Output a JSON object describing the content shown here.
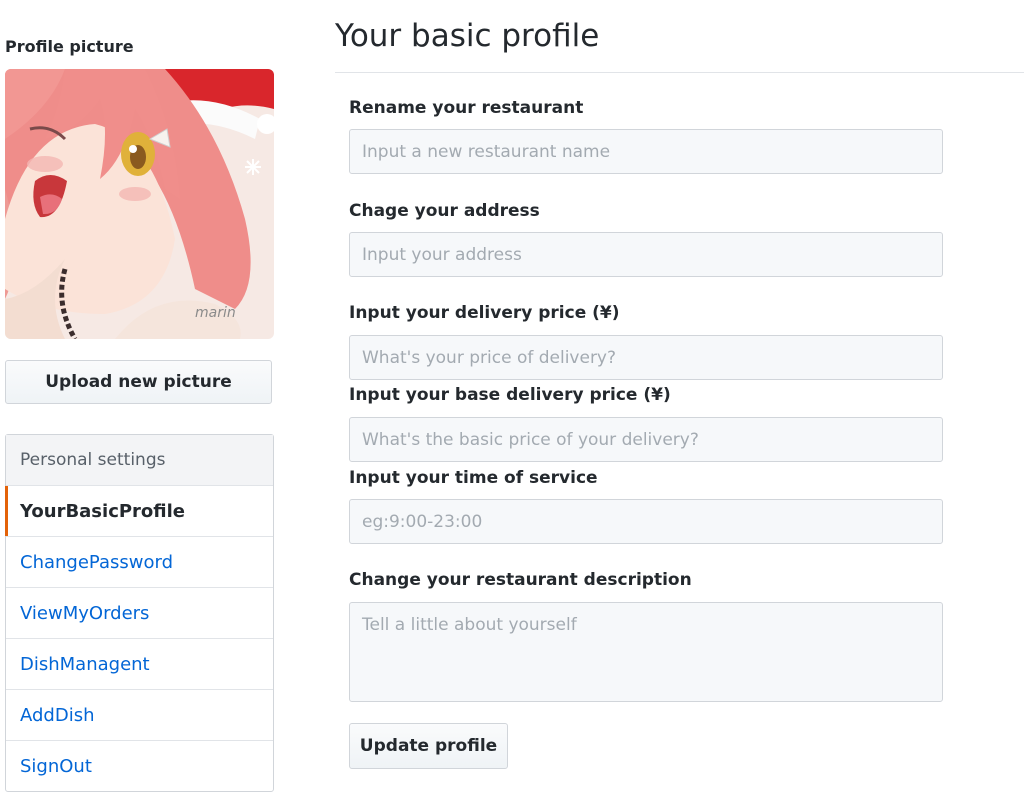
{
  "sidebar": {
    "profile_picture_label": "Profile picture",
    "avatar_signature": "marin",
    "upload_button": "Upload new picture",
    "menu_heading": "Personal settings",
    "items": [
      {
        "label": "YourBasicProfile",
        "selected": true
      },
      {
        "label": "ChangePassword",
        "selected": false
      },
      {
        "label": "ViewMyOrders",
        "selected": false
      },
      {
        "label": "DishManagent",
        "selected": false
      },
      {
        "label": "AddDish",
        "selected": false
      },
      {
        "label": "SignOut",
        "selected": false
      }
    ]
  },
  "main": {
    "title": "Your basic profile",
    "fields": {
      "rename": {
        "label": "Rename your restaurant",
        "placeholder": "Input a new restaurant name",
        "value": ""
      },
      "address": {
        "label": "Chage your address",
        "placeholder": "Input your address",
        "value": ""
      },
      "delivery_price": {
        "label": "Input your delivery price (¥)",
        "placeholder": "What's your price of delivery?",
        "value": ""
      },
      "base_delivery_price": {
        "label": "Input your base delivery price (¥)",
        "placeholder": "What's the basic price of your delivery?",
        "value": ""
      },
      "service_time": {
        "label": "Input your time of service",
        "placeholder": "eg:9:00-23:00",
        "value": ""
      },
      "description": {
        "label": "Change your restaurant description",
        "placeholder": "Tell a little about yourself",
        "value": ""
      }
    },
    "update_button": "Update profile"
  },
  "colors": {
    "link": "#0366d6",
    "selected_marker": "#e36209",
    "input_bg": "#f6f8fa",
    "border": "#d1d5da"
  }
}
